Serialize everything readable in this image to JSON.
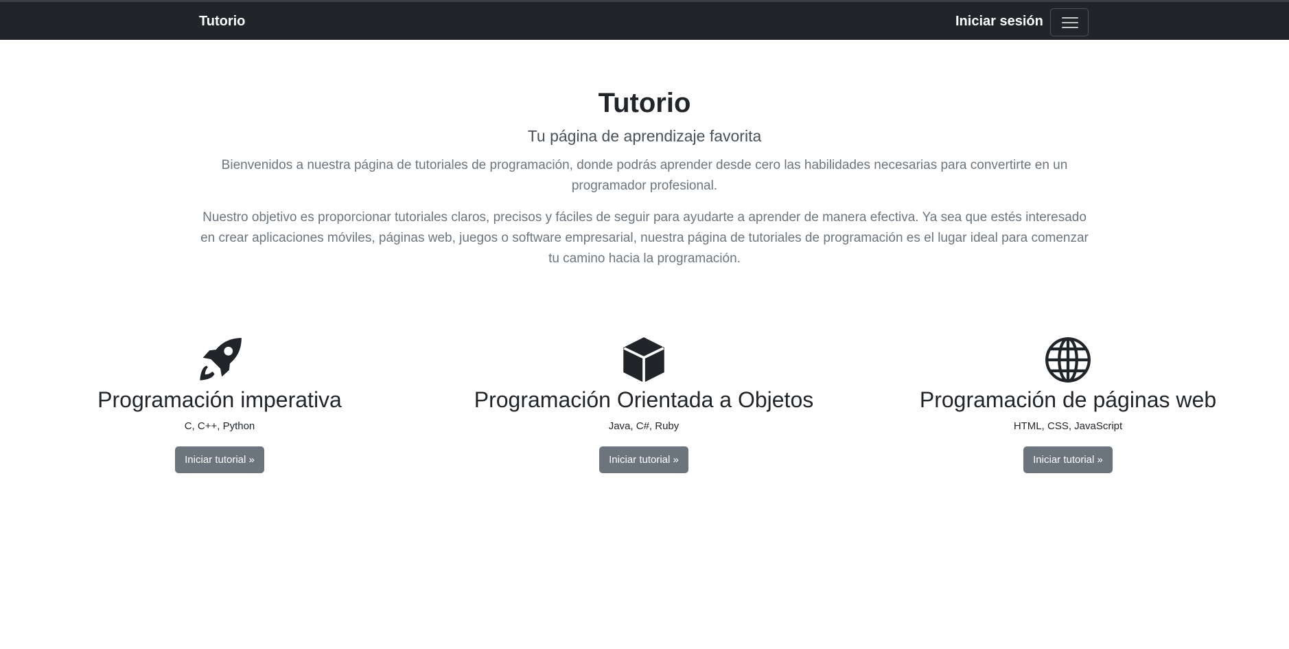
{
  "navbar": {
    "brand": "Tutorio",
    "login": "Iniciar sesión",
    "toggler_icon": "hamburger-icon"
  },
  "hero": {
    "title": "Tutorio",
    "subtitle": "Tu página de aprendizaje favorita",
    "paragraph1": "Bienvenidos a nuestra página de tutoriales de programación, donde podrás aprender desde cero las habilidades necesarias para convertirte en un programador profesional.",
    "paragraph2": "Nuestro objetivo es proporcionar tutoriales claros, precisos y fáciles de seguir para ayudarte a aprender de manera efectiva. Ya sea que estés interesado en crear aplicaciones móviles, páginas web, juegos o software empresarial, nuestra página de tutoriales de programación es el lugar ideal para comenzar tu camino hacia la programación."
  },
  "features": [
    {
      "icon": "rocket-icon",
      "title": "Programación imperativa",
      "languages": "C, C++, Python",
      "button": "Iniciar tutorial »"
    },
    {
      "icon": "box-icon",
      "title": "Programación Orientada a Objetos",
      "languages": "Java, C#, Ruby",
      "button": "Iniciar tutorial »"
    },
    {
      "icon": "globe-icon",
      "title": "Programación de páginas web",
      "languages": "HTML, CSS, JavaScript",
      "button": "Iniciar tutorial »"
    }
  ],
  "colors": {
    "navbar_bg": "#212529",
    "button_bg": "#6c757d",
    "muted_text": "#6c757d"
  }
}
